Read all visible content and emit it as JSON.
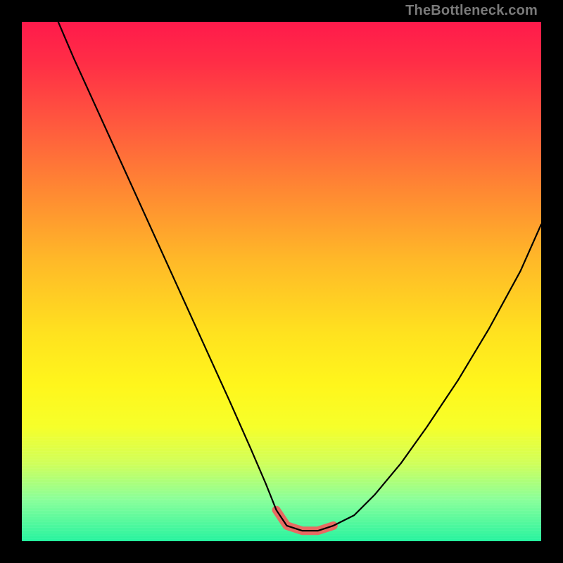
{
  "watermark": "TheBottleneck.com",
  "colors": {
    "frame": "#000000",
    "curve": "#000000",
    "valley_marker": "#e86a62",
    "gradient_top": "#ff1a4b",
    "gradient_bottom": "#27f39f"
  },
  "chart_data": {
    "type": "line",
    "title": "",
    "xlabel": "",
    "ylabel": "",
    "xlim": [
      0,
      100
    ],
    "ylim": [
      0,
      100
    ],
    "grid": false,
    "legend": false,
    "series": [
      {
        "name": "bottleneck-curve",
        "x": [
          7,
          10,
          15,
          20,
          25,
          30,
          35,
          40,
          44,
          47,
          49,
          51,
          54,
          57,
          60,
          64,
          68,
          73,
          78,
          84,
          90,
          96,
          100
        ],
        "values": [
          100,
          93,
          82,
          71,
          60,
          49,
          38,
          27,
          18,
          11,
          6,
          3,
          2,
          2,
          3,
          5,
          9,
          15,
          22,
          31,
          41,
          52,
          61
        ]
      }
    ],
    "annotations": [
      {
        "name": "valley-marker",
        "kind": "segment",
        "x": [
          49,
          51,
          54,
          57,
          60
        ],
        "y": [
          6,
          3,
          2,
          2,
          3
        ],
        "color": "#e86a62",
        "width": 12
      }
    ],
    "background": {
      "kind": "vertical-gradient",
      "stops": [
        {
          "pos": 0.0,
          "color": "#ff1a4b"
        },
        {
          "pos": 0.2,
          "color": "#ff5a3e"
        },
        {
          "pos": 0.46,
          "color": "#ffb928"
        },
        {
          "pos": 0.7,
          "color": "#fff61c"
        },
        {
          "pos": 0.88,
          "color": "#a9ff78"
        },
        {
          "pos": 1.0,
          "color": "#27f39f"
        }
      ]
    }
  }
}
